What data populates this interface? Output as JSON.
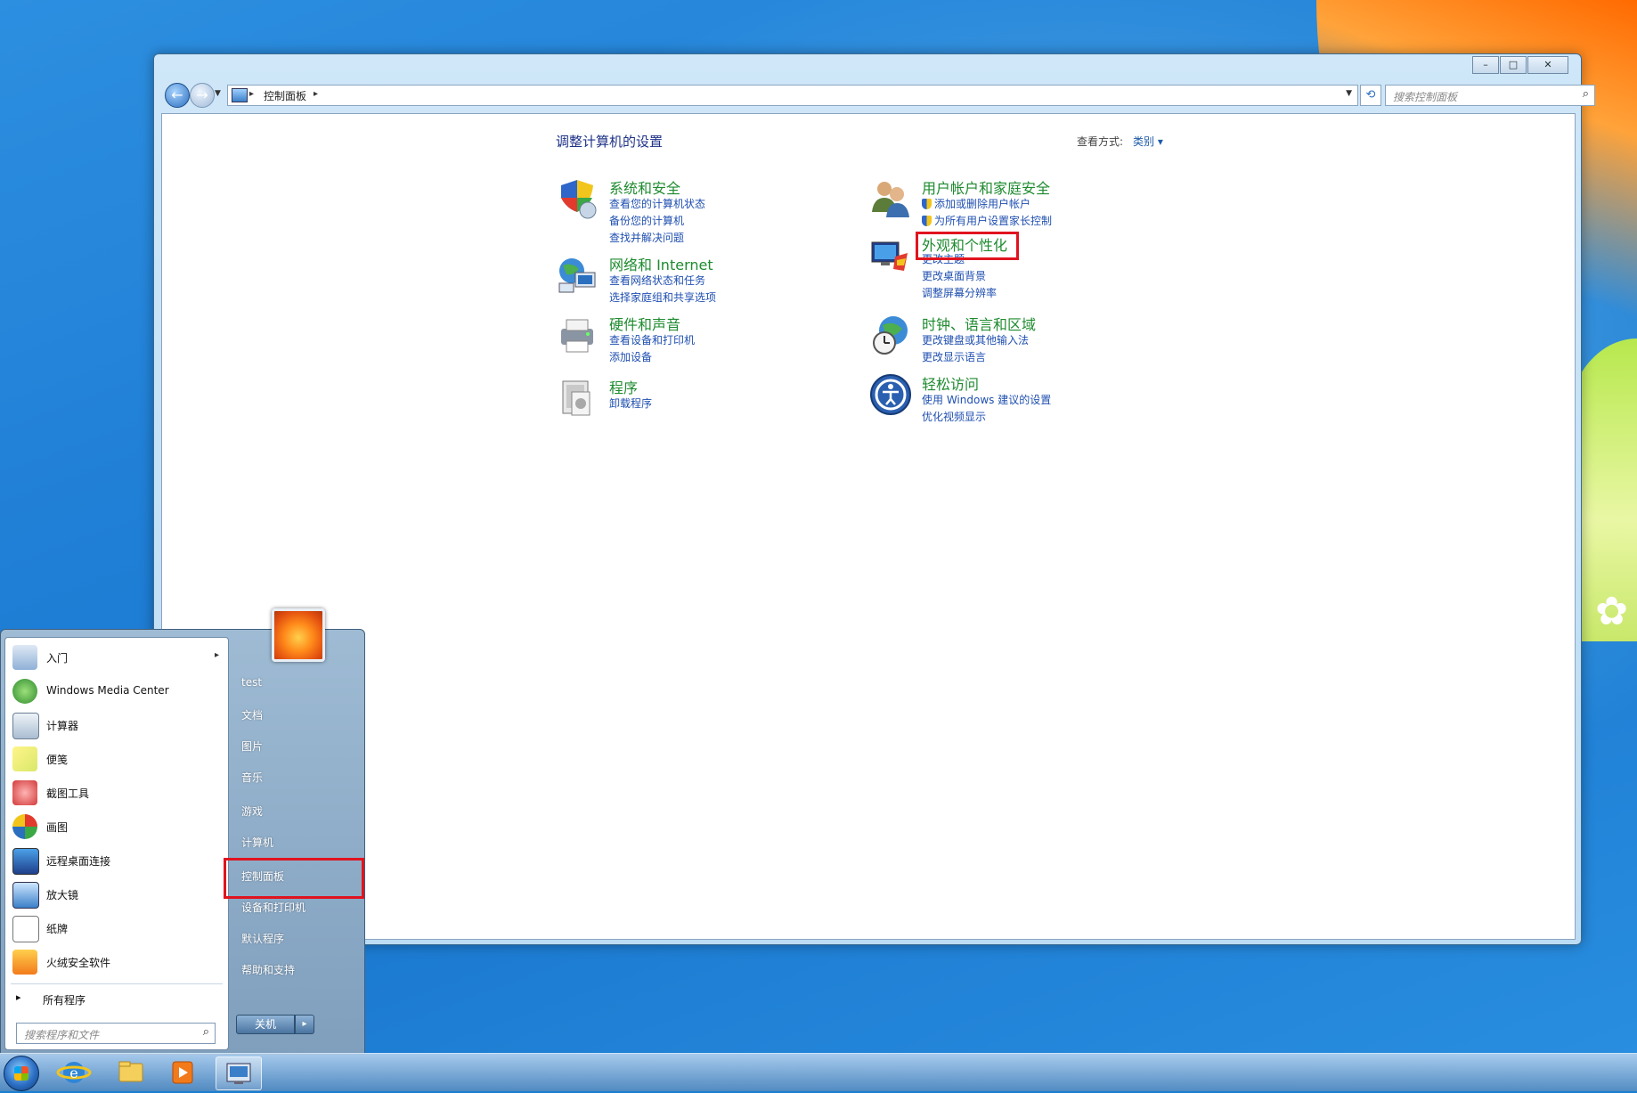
{
  "window": {
    "caption_buttons": [
      "–",
      "□",
      "✕"
    ],
    "address_path": "控制面板",
    "search_placeholder": "搜索控制面板",
    "page_title": "调整计算机的设置",
    "view_by_label": "查看方式:",
    "view_by_value": "类别 ▾"
  },
  "categories": {
    "system_security": {
      "title": "系统和安全",
      "links": [
        "查看您的计算机状态",
        "备份您的计算机",
        "查找并解决问题"
      ]
    },
    "network": {
      "title": "网络和 Internet",
      "links": [
        "查看网络状态和任务",
        "选择家庭组和共享选项"
      ]
    },
    "hardware": {
      "title": "硬件和声音",
      "links": [
        "查看设备和打印机",
        "添加设备"
      ]
    },
    "programs": {
      "title": "程序",
      "links": [
        "卸载程序"
      ]
    },
    "user_accounts": {
      "title": "用户帐户和家庭安全",
      "links": [
        "添加或删除用户帐户",
        "为所有用户设置家长控制"
      ]
    },
    "appearance": {
      "title": "外观和个性化",
      "links": [
        "更改主题",
        "更改桌面背景",
        "调整屏幕分辨率"
      ]
    },
    "clock": {
      "title": "时钟、语言和区域",
      "links": [
        "更改键盘或其他输入法",
        "更改显示语言"
      ]
    },
    "ease": {
      "title": "轻松访问",
      "links": [
        "使用 Windows 建议的设置",
        "优化视频显示"
      ]
    }
  },
  "start_menu": {
    "left_items": [
      "入门",
      "Windows Media Center",
      "计算器",
      "便笺",
      "截图工具",
      "画图",
      "远程桌面连接",
      "放大镜",
      "纸牌",
      "火绒安全软件"
    ],
    "all_programs": "所有程序",
    "search_placeholder": "搜索程序和文件",
    "right_items": [
      "test",
      "文档",
      "图片",
      "音乐",
      "游戏",
      "计算机",
      "控制面板",
      "设备和打印机",
      "默认程序",
      "帮助和支持"
    ],
    "shutdown": "关机"
  },
  "taskbar": {
    "items": [
      "internet-explorer",
      "windows-explorer",
      "media-player",
      "control-panel"
    ]
  },
  "colors": {
    "highlight": "#e0141e",
    "category_title": "#1e8b2f",
    "link": "#1f4fb0"
  }
}
